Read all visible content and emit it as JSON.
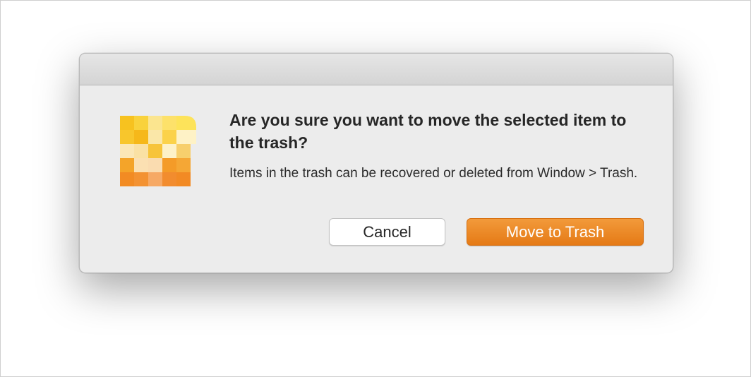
{
  "dialog": {
    "icon": "app-icon-yellow-orange-blocks",
    "headline": "Are you sure you want to move the selected item to the trash?",
    "message": "Items in the trash can be recovered or deleted from Window > Trash.",
    "buttons": {
      "cancel_label": "Cancel",
      "confirm_label": "Move to Trash"
    },
    "colors": {
      "accent": "#E8841F",
      "dialog_bg": "#ECECEC"
    }
  }
}
